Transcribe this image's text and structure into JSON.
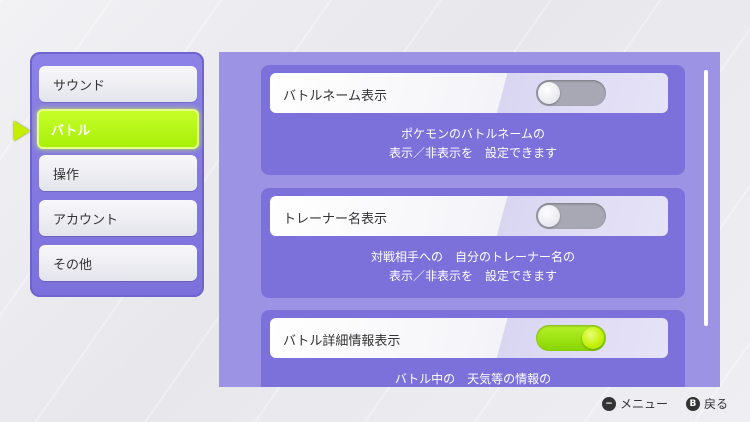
{
  "sidebar": {
    "items": [
      {
        "label": "サウンド",
        "selected": false
      },
      {
        "label": "バトル",
        "selected": true
      },
      {
        "label": "操作",
        "selected": false
      },
      {
        "label": "アカウント",
        "selected": false
      },
      {
        "label": "その他",
        "selected": false
      }
    ]
  },
  "settings": [
    {
      "title": "バトルネーム表示",
      "toggle_on": false,
      "desc_line1": "ポケモンのバトルネームの",
      "desc_line2": "表示／非表示を　設定できます"
    },
    {
      "title": "トレーナー名表示",
      "toggle_on": false,
      "desc_line1": "対戦相手への　自分のトレーナー名の",
      "desc_line2": "表示／非表示を　設定できます"
    },
    {
      "title": "バトル詳細情報表示",
      "toggle_on": true,
      "desc_line1": "バトル中の　天気等の情報の",
      "desc_line2": ""
    }
  ],
  "footer": {
    "menu_button_icon": "−",
    "menu_label": "メニュー",
    "back_button_icon": "B",
    "back_label": "戻る"
  },
  "colors": {
    "accent_green": "#b6f22a",
    "panel_purple": "#7c71da"
  }
}
